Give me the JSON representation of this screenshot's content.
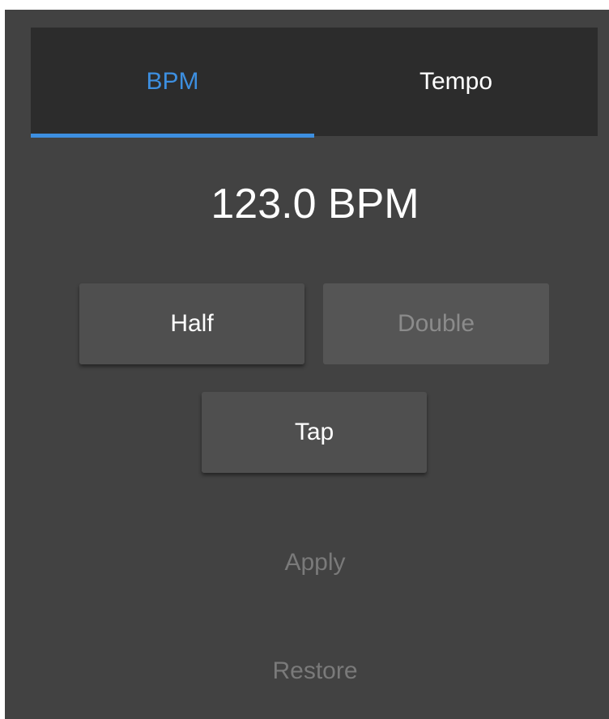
{
  "tabs": [
    {
      "label": "BPM",
      "active": true
    },
    {
      "label": "Tempo",
      "active": false
    }
  ],
  "bpm_display": "123.0 BPM",
  "buttons": {
    "half": "Half",
    "double": "Double",
    "tap": "Tap",
    "apply": "Apply",
    "restore": "Restore"
  },
  "colors": {
    "accent": "#3d8fe0",
    "background": "#424242",
    "tabbar": "#2c2c2c"
  }
}
